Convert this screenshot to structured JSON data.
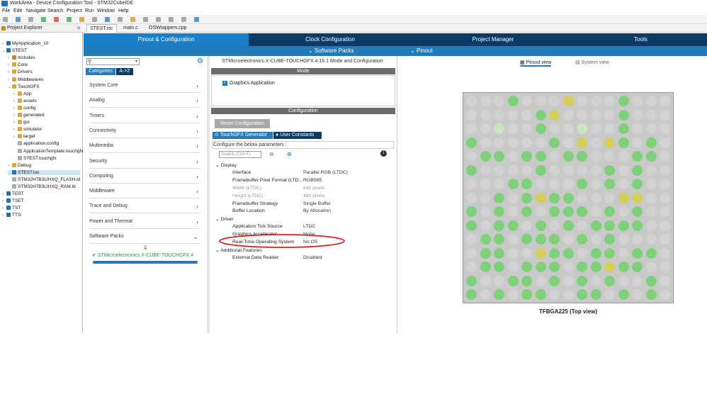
{
  "window": {
    "title": "WorkArea - Device Configuration Tool - STM32CubeIDE"
  },
  "menu": [
    "File",
    "Edit",
    "Navigate",
    "Search",
    "Project",
    "Run",
    "Window",
    "Help"
  ],
  "explorer": {
    "title": "Project Explorer",
    "items": [
      {
        "label": "MyApplication_10",
        "indent": 0,
        "exp": ">",
        "icon": "#1f6fb5"
      },
      {
        "label": "STEST",
        "indent": 0,
        "exp": "v",
        "icon": "#1f6fb5"
      },
      {
        "label": "Includes",
        "indent": 1,
        "exp": ">",
        "icon": "#c98a2b"
      },
      {
        "label": "Core",
        "indent": 1,
        "exp": ">",
        "icon": "#d9a740"
      },
      {
        "label": "Drivers",
        "indent": 1,
        "exp": ">",
        "icon": "#d9a740"
      },
      {
        "label": "Middlewares",
        "indent": 1,
        "exp": ">",
        "icon": "#d9a740"
      },
      {
        "label": "TouchGFX",
        "indent": 1,
        "exp": "v",
        "icon": "#d9a740"
      },
      {
        "label": "App",
        "indent": 2,
        "exp": ">",
        "icon": "#d9a740"
      },
      {
        "label": "assets",
        "indent": 2,
        "exp": ">",
        "icon": "#d9a740"
      },
      {
        "label": "config",
        "indent": 2,
        "exp": ">",
        "icon": "#d9a740"
      },
      {
        "label": "generated",
        "indent": 2,
        "exp": ">",
        "icon": "#d9a740"
      },
      {
        "label": "gui",
        "indent": 2,
        "exp": ">",
        "icon": "#d9a740"
      },
      {
        "label": "simulator",
        "indent": 2,
        "exp": ">",
        "icon": "#d9a740"
      },
      {
        "label": "target",
        "indent": 2,
        "exp": ">",
        "icon": "#d9a740"
      },
      {
        "label": "application.config",
        "indent": 2,
        "exp": "",
        "icon": "#aaaaaa"
      },
      {
        "label": "ApplicationTemplate.touchgfx.part",
        "indent": 2,
        "exp": "",
        "icon": "#aaaaaa"
      },
      {
        "label": "STEST.touchgfx",
        "indent": 2,
        "exp": "",
        "icon": "#aaaaaa"
      },
      {
        "label": "Debug",
        "indent": 1,
        "exp": ">",
        "icon": "#d9a740"
      },
      {
        "label": "STEST.ioc",
        "indent": 1,
        "exp": "",
        "icon": "#1f6fb5",
        "sel": true
      },
      {
        "label": "STM32H7B3LIHXQ_FLASH.ld",
        "indent": 1,
        "exp": "",
        "icon": "#aaaaaa"
      },
      {
        "label": "STM32H7B3LIHXQ_RAM.ld",
        "indent": 1,
        "exp": "",
        "icon": "#aaaaaa"
      },
      {
        "label": "TEST",
        "indent": 0,
        "exp": ">",
        "icon": "#1f6fb5"
      },
      {
        "label": "TSET",
        "indent": 0,
        "exp": ">",
        "icon": "#1f6fb5"
      },
      {
        "label": "TST",
        "indent": 0,
        "exp": ">",
        "icon": "#1f6fb5"
      },
      {
        "label": "TTS",
        "indent": 0,
        "exp": ">",
        "icon": "#1f6fb5"
      }
    ]
  },
  "editor_tabs": [
    "STEST.ioc",
    "main.c",
    "OSWrappers.cpp"
  ],
  "main_tabs": [
    "Pinout & Configuration",
    "Clock Configuration",
    "Project Manager",
    "Tools"
  ],
  "subbar": {
    "software_packs": "Software Packs",
    "pinout": "Pinout"
  },
  "categories": {
    "tab_categories": "Categories",
    "tab_az": "A->Z",
    "items": [
      "System Core",
      "Analog",
      "Timers",
      "Connectivity",
      "Multimedia",
      "Security",
      "Computing",
      "Middleware",
      "Trace and Debug",
      "Power and Thermal",
      "Software Packs"
    ],
    "selected_pack": "STMicroelectronics.X-CUBE-TOUCHGFX.4"
  },
  "mode": {
    "pack_title": "STMicroelectronics.X-CUBE-TOUCHGFX.4.16.1 Mode and Configuration",
    "mode_bar": "Mode",
    "graphics_app": "Graphics Application",
    "config_bar": "Configuration",
    "reset_btn": "Reset Configuration",
    "tab_touchgfx": "TouchGFX Generator",
    "tab_user": "User Constants",
    "configure_text": "Configure the below parameters :",
    "search_placeholder": "Search (Crtl+F)"
  },
  "params": [
    {
      "type": "group",
      "label": "Display"
    },
    {
      "label": "Interface",
      "value": "Parallel RGB (LTDC)"
    },
    {
      "label": "Framebuffer Pixel Format (LTD...",
      "value": "RGB565"
    },
    {
      "label": "Width (LTDC)",
      "value": "640 pixels",
      "gray": true
    },
    {
      "label": "Height (LTDC)",
      "value": "480 pixels",
      "gray": true
    },
    {
      "label": "Framebuffer Strategy",
      "value": "Single Buffer"
    },
    {
      "label": "Buffer Location",
      "value": "By Allocation"
    },
    {
      "type": "group",
      "label": "Driver"
    },
    {
      "label": "Application Tick Source",
      "value": "LTDC"
    },
    {
      "label": "Graphics Accelerator",
      "value": "None"
    },
    {
      "label": "Real-Time Operating System",
      "value": "No OS"
    },
    {
      "type": "group",
      "label": "Additional Features"
    },
    {
      "label": "External Data Reader",
      "value": "Disabled"
    }
  ],
  "pinout": {
    "pinout_view": "Pinout view",
    "system_view": "System view",
    "chip_label": "TFBGA225 (Top view)",
    "colors": {
      "green": "#7ed17a",
      "gray": "#d2d2d2",
      "yellow": "#d4cf5a",
      "pale": "#c8e6c0"
    }
  }
}
